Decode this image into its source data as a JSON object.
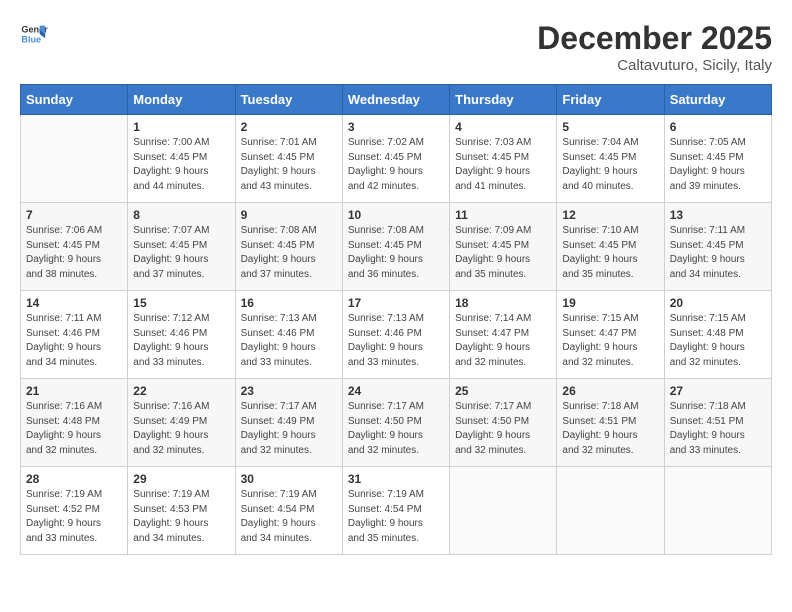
{
  "logo": {
    "line1": "General",
    "line2": "Blue"
  },
  "title": "December 2025",
  "subtitle": "Caltavuturo, Sicily, Italy",
  "days_header": [
    "Sunday",
    "Monday",
    "Tuesday",
    "Wednesday",
    "Thursday",
    "Friday",
    "Saturday"
  ],
  "weeks": [
    [
      {
        "day": "",
        "info": ""
      },
      {
        "day": "1",
        "info": "Sunrise: 7:00 AM\nSunset: 4:45 PM\nDaylight: 9 hours\nand 44 minutes."
      },
      {
        "day": "2",
        "info": "Sunrise: 7:01 AM\nSunset: 4:45 PM\nDaylight: 9 hours\nand 43 minutes."
      },
      {
        "day": "3",
        "info": "Sunrise: 7:02 AM\nSunset: 4:45 PM\nDaylight: 9 hours\nand 42 minutes."
      },
      {
        "day": "4",
        "info": "Sunrise: 7:03 AM\nSunset: 4:45 PM\nDaylight: 9 hours\nand 41 minutes."
      },
      {
        "day": "5",
        "info": "Sunrise: 7:04 AM\nSunset: 4:45 PM\nDaylight: 9 hours\nand 40 minutes."
      },
      {
        "day": "6",
        "info": "Sunrise: 7:05 AM\nSunset: 4:45 PM\nDaylight: 9 hours\nand 39 minutes."
      }
    ],
    [
      {
        "day": "7",
        "info": "Sunrise: 7:06 AM\nSunset: 4:45 PM\nDaylight: 9 hours\nand 38 minutes."
      },
      {
        "day": "8",
        "info": "Sunrise: 7:07 AM\nSunset: 4:45 PM\nDaylight: 9 hours\nand 37 minutes."
      },
      {
        "day": "9",
        "info": "Sunrise: 7:08 AM\nSunset: 4:45 PM\nDaylight: 9 hours\nand 37 minutes."
      },
      {
        "day": "10",
        "info": "Sunrise: 7:08 AM\nSunset: 4:45 PM\nDaylight: 9 hours\nand 36 minutes."
      },
      {
        "day": "11",
        "info": "Sunrise: 7:09 AM\nSunset: 4:45 PM\nDaylight: 9 hours\nand 35 minutes."
      },
      {
        "day": "12",
        "info": "Sunrise: 7:10 AM\nSunset: 4:45 PM\nDaylight: 9 hours\nand 35 minutes."
      },
      {
        "day": "13",
        "info": "Sunrise: 7:11 AM\nSunset: 4:45 PM\nDaylight: 9 hours\nand 34 minutes."
      }
    ],
    [
      {
        "day": "14",
        "info": "Sunrise: 7:11 AM\nSunset: 4:46 PM\nDaylight: 9 hours\nand 34 minutes."
      },
      {
        "day": "15",
        "info": "Sunrise: 7:12 AM\nSunset: 4:46 PM\nDaylight: 9 hours\nand 33 minutes."
      },
      {
        "day": "16",
        "info": "Sunrise: 7:13 AM\nSunset: 4:46 PM\nDaylight: 9 hours\nand 33 minutes."
      },
      {
        "day": "17",
        "info": "Sunrise: 7:13 AM\nSunset: 4:46 PM\nDaylight: 9 hours\nand 33 minutes."
      },
      {
        "day": "18",
        "info": "Sunrise: 7:14 AM\nSunset: 4:47 PM\nDaylight: 9 hours\nand 32 minutes."
      },
      {
        "day": "19",
        "info": "Sunrise: 7:15 AM\nSunset: 4:47 PM\nDaylight: 9 hours\nand 32 minutes."
      },
      {
        "day": "20",
        "info": "Sunrise: 7:15 AM\nSunset: 4:48 PM\nDaylight: 9 hours\nand 32 minutes."
      }
    ],
    [
      {
        "day": "21",
        "info": "Sunrise: 7:16 AM\nSunset: 4:48 PM\nDaylight: 9 hours\nand 32 minutes."
      },
      {
        "day": "22",
        "info": "Sunrise: 7:16 AM\nSunset: 4:49 PM\nDaylight: 9 hours\nand 32 minutes."
      },
      {
        "day": "23",
        "info": "Sunrise: 7:17 AM\nSunset: 4:49 PM\nDaylight: 9 hours\nand 32 minutes."
      },
      {
        "day": "24",
        "info": "Sunrise: 7:17 AM\nSunset: 4:50 PM\nDaylight: 9 hours\nand 32 minutes."
      },
      {
        "day": "25",
        "info": "Sunrise: 7:17 AM\nSunset: 4:50 PM\nDaylight: 9 hours\nand 32 minutes."
      },
      {
        "day": "26",
        "info": "Sunrise: 7:18 AM\nSunset: 4:51 PM\nDaylight: 9 hours\nand 32 minutes."
      },
      {
        "day": "27",
        "info": "Sunrise: 7:18 AM\nSunset: 4:51 PM\nDaylight: 9 hours\nand 33 minutes."
      }
    ],
    [
      {
        "day": "28",
        "info": "Sunrise: 7:19 AM\nSunset: 4:52 PM\nDaylight: 9 hours\nand 33 minutes."
      },
      {
        "day": "29",
        "info": "Sunrise: 7:19 AM\nSunset: 4:53 PM\nDaylight: 9 hours\nand 34 minutes."
      },
      {
        "day": "30",
        "info": "Sunrise: 7:19 AM\nSunset: 4:54 PM\nDaylight: 9 hours\nand 34 minutes."
      },
      {
        "day": "31",
        "info": "Sunrise: 7:19 AM\nSunset: 4:54 PM\nDaylight: 9 hours\nand 35 minutes."
      },
      {
        "day": "",
        "info": ""
      },
      {
        "day": "",
        "info": ""
      },
      {
        "day": "",
        "info": ""
      }
    ]
  ]
}
